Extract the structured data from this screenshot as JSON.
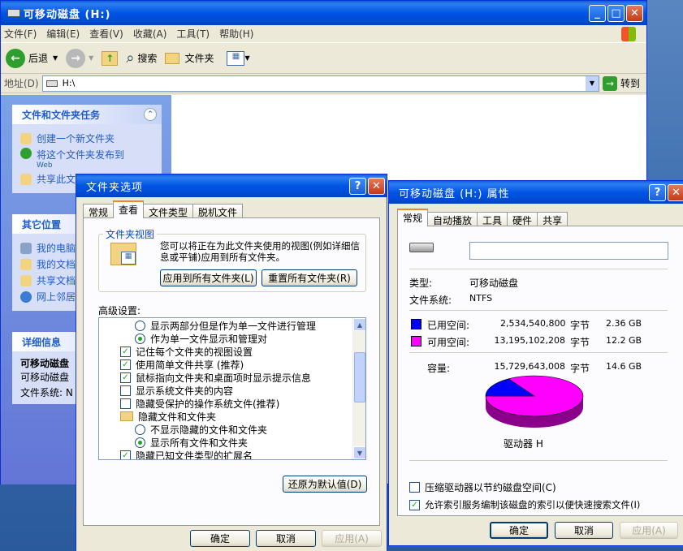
{
  "explorer": {
    "title": "可移动磁盘 (H:)",
    "menu": [
      "文件(F)",
      "编辑(E)",
      "查看(V)",
      "收藏(A)",
      "工具(T)",
      "帮助(H)"
    ],
    "back": "后退",
    "search": "搜索",
    "folders": "文件夹",
    "address_label": "地址(D)",
    "address_value": "H:\\",
    "go": "转到",
    "tasks": {
      "header": "文件和文件夹任务",
      "items": [
        "创建一个新文件夹",
        "将这个文件夹发布到",
        "Web",
        "共享此文件夹"
      ]
    },
    "places": {
      "header": "其它位置",
      "items": [
        "我的电脑",
        "我的文档",
        "共享文档",
        "网上邻居"
      ]
    },
    "details": {
      "header": "详细信息",
      "name": "可移动磁盘",
      "type": "可移动磁盘",
      "fs": "文件系统: N"
    }
  },
  "folder_options": {
    "title": "文件夹选项",
    "tabs": [
      "常规",
      "查看",
      "文件类型",
      "脱机文件"
    ],
    "group_label": "文件夹视图",
    "desc": "您可以将正在为此文件夹使用的视图(例如详细信息或平铺)应用到所有文件夹。",
    "apply_all": "应用到所有文件夹(L)",
    "reset_all": "重置所有文件夹(R)",
    "advanced_label": "高级设置:",
    "advanced": [
      {
        "kind": "radio",
        "checked": false,
        "indent": 2,
        "text": "显示两部分但是作为单一文件进行管理"
      },
      {
        "kind": "radio",
        "checked": true,
        "indent": 2,
        "text": "作为单一文件显示和管理对"
      },
      {
        "kind": "check",
        "checked": true,
        "indent": 1,
        "text": "记住每个文件夹的视图设置"
      },
      {
        "kind": "check",
        "checked": true,
        "indent": 1,
        "text": "使用简单文件共享 (推荐)"
      },
      {
        "kind": "check",
        "checked": true,
        "indent": 1,
        "text": "鼠标指向文件夹和桌面项时显示提示信息"
      },
      {
        "kind": "check",
        "checked": false,
        "indent": 1,
        "text": "显示系统文件夹的内容"
      },
      {
        "kind": "check",
        "checked": false,
        "indent": 1,
        "text": "隐藏受保护的操作系统文件(推荐)"
      },
      {
        "kind": "folder",
        "indent": 1,
        "text": "隐藏文件和文件夹"
      },
      {
        "kind": "radio",
        "checked": false,
        "indent": 2,
        "text": "不显示隐藏的文件和文件夹"
      },
      {
        "kind": "radio",
        "checked": true,
        "indent": 2,
        "text": "显示所有文件和文件夹"
      },
      {
        "kind": "check",
        "checked": true,
        "indent": 1,
        "text": "隐藏已知文件类型的扩展名"
      }
    ],
    "restore": "还原为默认值(D)",
    "ok": "确定",
    "cancel": "取消",
    "apply": "应用(A)"
  },
  "properties": {
    "title": "可移动磁盘 (H:) 属性",
    "tabs": [
      "常规",
      "自动播放",
      "工具",
      "硬件",
      "共享"
    ],
    "label_value": "",
    "type_label": "类型:",
    "type_value": "可移动磁盘",
    "fs_label": "文件系统:",
    "fs_value": "NTFS",
    "used": {
      "label": "已用空间:",
      "bytes": "2,534,540,800",
      "unit": "字节",
      "size": "2.36 GB",
      "color": "#0000ff"
    },
    "free": {
      "label": "可用空间:",
      "bytes": "13,195,102,208",
      "unit": "字节",
      "size": "12.2 GB",
      "color": "#ff00ff"
    },
    "cap": {
      "label": "容量:",
      "bytes": "15,729,643,008",
      "unit": "字节",
      "size": "14.6 GB"
    },
    "drive": "驱动器 H",
    "used_fraction": 0.161,
    "compress": "压缩驱动器以节约磁盘空间(C)",
    "compress_checked": false,
    "index": "允许索引服务编制该磁盘的索引以便快速搜索文件(I)",
    "index_checked": true,
    "ok": "确定",
    "cancel": "取消",
    "apply": "应用(A)"
  }
}
